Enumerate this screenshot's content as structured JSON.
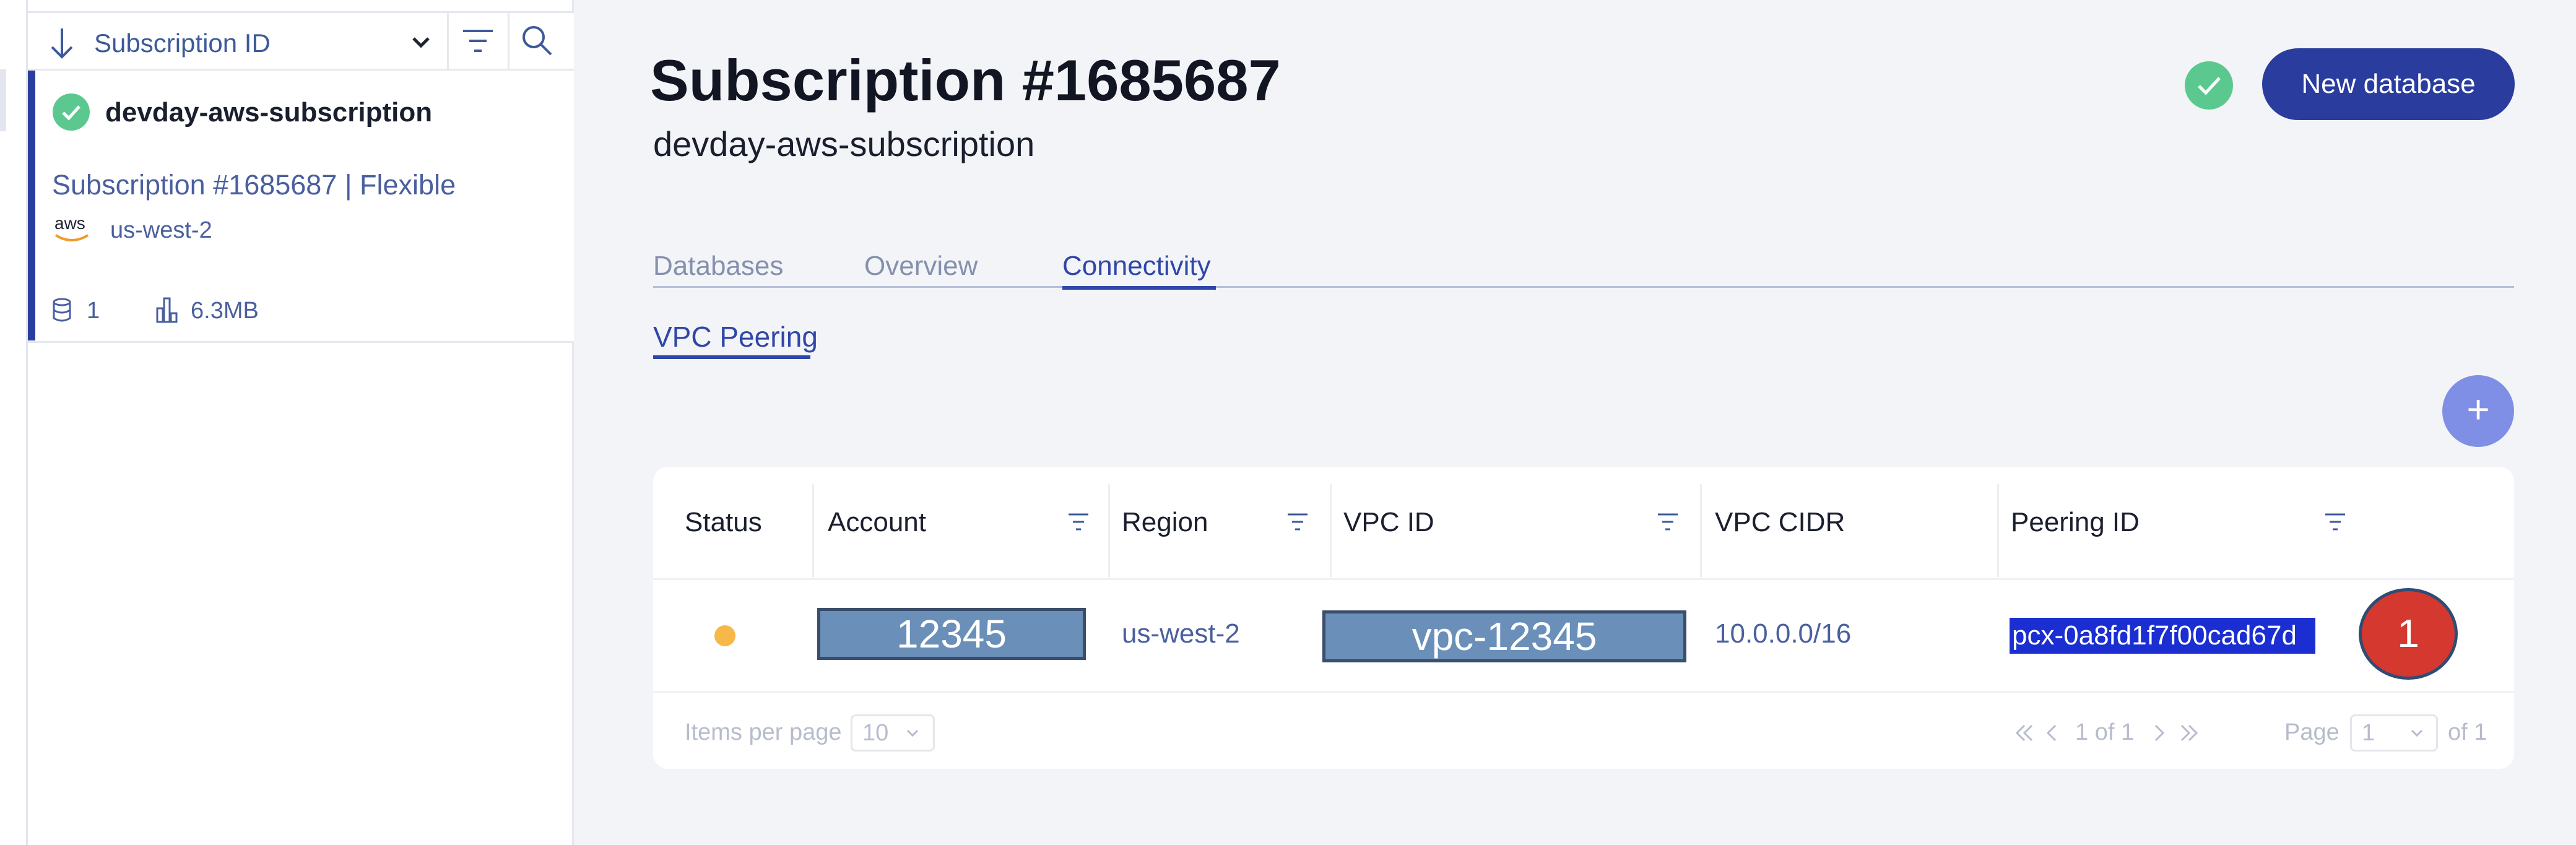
{
  "sidebar": {
    "sort_label": "Subscription ID",
    "card": {
      "name": "devday-aws-subscription",
      "subscription_line": "Subscription #1685687 | Flexible",
      "provider_logo_text": "aws",
      "region": "us-west-2",
      "db_count": "1",
      "memory": "6.3MB"
    },
    "icons": [
      "sort-arrow-icon",
      "chevron-down-icon",
      "filter-icon",
      "search-icon",
      "check-circle-icon",
      "aws-logo-icon",
      "database-icon",
      "memory-chart-icon"
    ]
  },
  "header": {
    "title": "Subscription #1685687",
    "subtitle": "devday-aws-subscription",
    "new_database_label": "New database"
  },
  "tabs": [
    {
      "label": "Databases",
      "active": false
    },
    {
      "label": "Overview",
      "active": false
    },
    {
      "label": "Connectivity",
      "active": true
    }
  ],
  "subtabs": [
    {
      "label": "VPC Peering",
      "active": true
    }
  ],
  "add_button_label": "+",
  "table": {
    "columns": [
      "Status",
      "Account",
      "Region",
      "VPC ID",
      "VPC CIDR",
      "Peering ID"
    ],
    "rows": [
      {
        "status_color": "#f7b84a",
        "account": "12345",
        "region": "us-west-2",
        "vpc_id": "vpc-12345",
        "vpc_cidr": "10.0.0.0/16",
        "peering_id": "pcx-0a8fd1f7f00cad67d",
        "marker": "1"
      }
    ],
    "pagination": {
      "items_per_page_label": "Items per page",
      "items_per_page": "10",
      "range": "1 of 1",
      "page_label": "Page",
      "page": "1",
      "of_label": "of 1"
    }
  },
  "colors": {
    "primary": "#2a3c9e",
    "accent_link": "#2f47a8",
    "success": "#5bc98f",
    "add_button": "#7f8fe6",
    "selection": "#1a2ed2",
    "marker": "#d5382e"
  }
}
